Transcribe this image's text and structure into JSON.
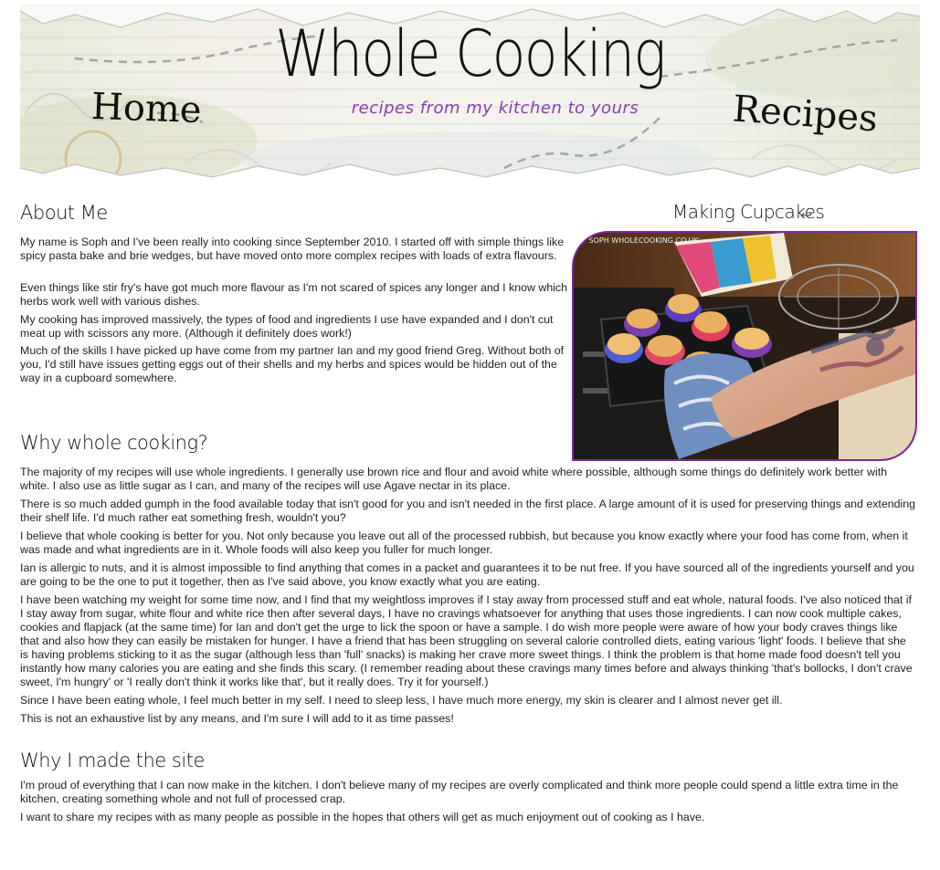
{
  "header": {
    "site_title": "Whole Cooking",
    "tagline": "recipes from my kitchen to yours",
    "nav": [
      {
        "label": "Home"
      },
      {
        "label": "Recipes"
      }
    ]
  },
  "sidebar": {
    "title": "Making Cupcakes",
    "photo_watermark": "© SOPH WHOLECOOKING.CO.UK"
  },
  "sections": [
    {
      "heading": "About Me",
      "paragraphs": [
        "My name is Soph and I've been really into cooking since September 2010. I started off with simple things like spicy pasta bake and brie wedges, but have moved onto more complex recipes with loads of extra flavours.",
        "Even things like stir fry's have got much more flavour as I'm not scared of spices any longer and I know which herbs work well with various dishes.",
        "My cooking has improved massively, the types of food and ingredients I use have expanded and I don't cut meat up with scissors any more. (Although it definitely does work!)",
        "Much of the skills I have picked up have come from my partner Ian and my good friend Greg. Without both of you, I'd still have issues getting eggs out of their shells and my herbs and spices would be hidden out of the way in a cupboard somewhere."
      ]
    },
    {
      "heading": "Why whole cooking?",
      "paragraphs": [
        "The majority of my recipes will use whole ingredients. I generally use brown rice and flour and avoid white where possible, although some things do definitely work better with white. I also use as little sugar as I can, and many of the recipes will use Agave nectar in its place.",
        "There is so much added gumph in the food available today that isn't good for you and isn't needed in the first place. A large amount of it is used for preserving things and extending their shelf life. I'd much rather eat something fresh, wouldn't you?",
        "I believe that whole cooking is better for you. Not only because you leave out all of the processed rubbish, but because you know exactly where your food has come from, when it was made and what ingredients are in it. Whole foods will also keep you fuller for much longer.",
        "Ian is allergic to nuts, and it is almost impossible to find anything that comes in a packet and guarantees it to be nut free. If you have sourced all of the ingredients yourself and you are going to be the one to put it together, then as I've said above, you know exactly what you are eating.",
        "I have been watching my weight for some time now, and I find that my weightloss improves if I stay away from processed stuff and eat whole, natural foods. I've also noticed that if I stay away from sugar, white flour and white rice then after several days, I have no cravings whatsoever for anything that uses those ingredients. I can now cook multiple cakes, cookies and flapjack (at the same time) for Ian and don't get the urge to lick the spoon or have a sample. I do wish more people were aware of how your body craves things like that and also how they can easily be mistaken for hunger. I have a friend that has been struggling on several calorie controlled diets, eating various 'light' foods. I believe that she is having problems sticking to it as the sugar (although less than 'full' snacks) is making her crave more sweet things. I think the problem is that home made food doesn't tell you instantly how many calories you are eating and she finds this scary. (I remember reading about these cravings many times before and always thinking 'that's bollocks, I don't crave sweet, I'm hungry' or 'I really don't think it works like that', but it really does. Try it for yourself.)",
        "Since I have been eating whole, I feel much better in my self. I need to sleep less, I have much more energy, my skin is clearer and I almost never get ill.",
        "This is not an exhaustive list by any means, and I'm sure I will add to it as time passes!"
      ]
    },
    {
      "heading": "Why I made the site",
      "paragraphs": [
        "I'm proud of everything that I can now make in the kitchen. I don't believe many of my recipes are overly complicated and think more people could spend a little extra time in the kitchen, creating something whole and not full of processed crap.",
        "I want to share my recipes with as many people as possible in the hopes that others will get as much enjoyment out of cooking as I have."
      ]
    }
  ]
}
